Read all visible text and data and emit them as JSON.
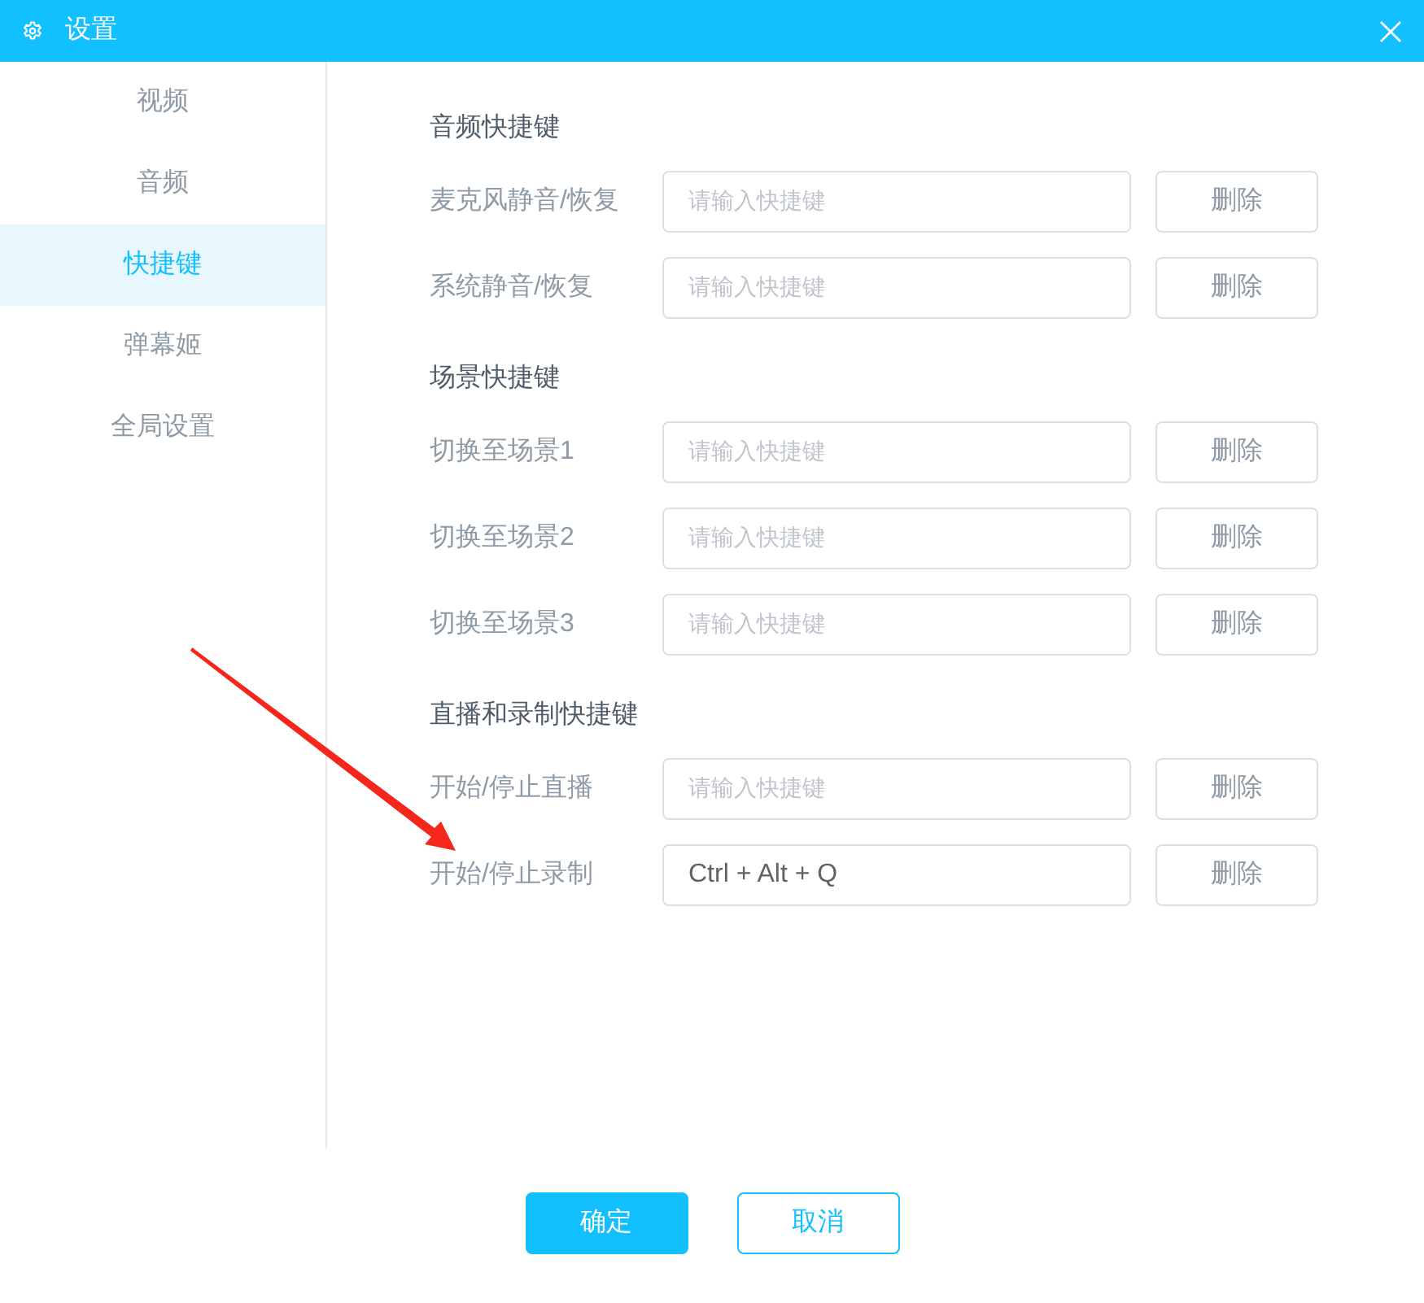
{
  "window": {
    "title": "设置"
  },
  "sidebar": {
    "items": [
      {
        "label": "视频",
        "selected": false
      },
      {
        "label": "音频",
        "selected": false
      },
      {
        "label": "快捷键",
        "selected": true
      },
      {
        "label": "弹幕姬",
        "selected": false
      },
      {
        "label": "全局设置",
        "selected": false
      }
    ]
  },
  "sections": [
    {
      "title": "音频快捷键",
      "rows": [
        {
          "label": "麦克风静音/恢复",
          "placeholder": "请输入快捷键",
          "button": "删除"
        },
        {
          "label": "系统静音/恢复",
          "placeholder": "请输入快捷键",
          "button": "删除"
        }
      ]
    },
    {
      "title": "场景快捷键",
      "rows": [
        {
          "label": "切换至场景1",
          "placeholder": "请输入快捷键",
          "button": "删除"
        },
        {
          "label": "切换至场景2",
          "placeholder": "请输入快捷键",
          "button": "删除"
        },
        {
          "label": "切换至场景3",
          "placeholder": "请输入快捷键",
          "button": "删除"
        }
      ]
    },
    {
      "title": "直播和录制快捷键",
      "rows": [
        {
          "label": "开始/停止直播",
          "placeholder": "请输入快捷键",
          "button": "删除"
        },
        {
          "label": "开始/停止录制",
          "value": "Ctrl + Alt + Q",
          "button": "删除"
        }
      ]
    }
  ],
  "footer": {
    "buttons": [
      {
        "label": "确定",
        "kind": "primary"
      },
      {
        "label": "取消",
        "kind": "secondary"
      }
    ]
  },
  "annotations": [
    {
      "kind": "arrow"
    }
  ]
}
